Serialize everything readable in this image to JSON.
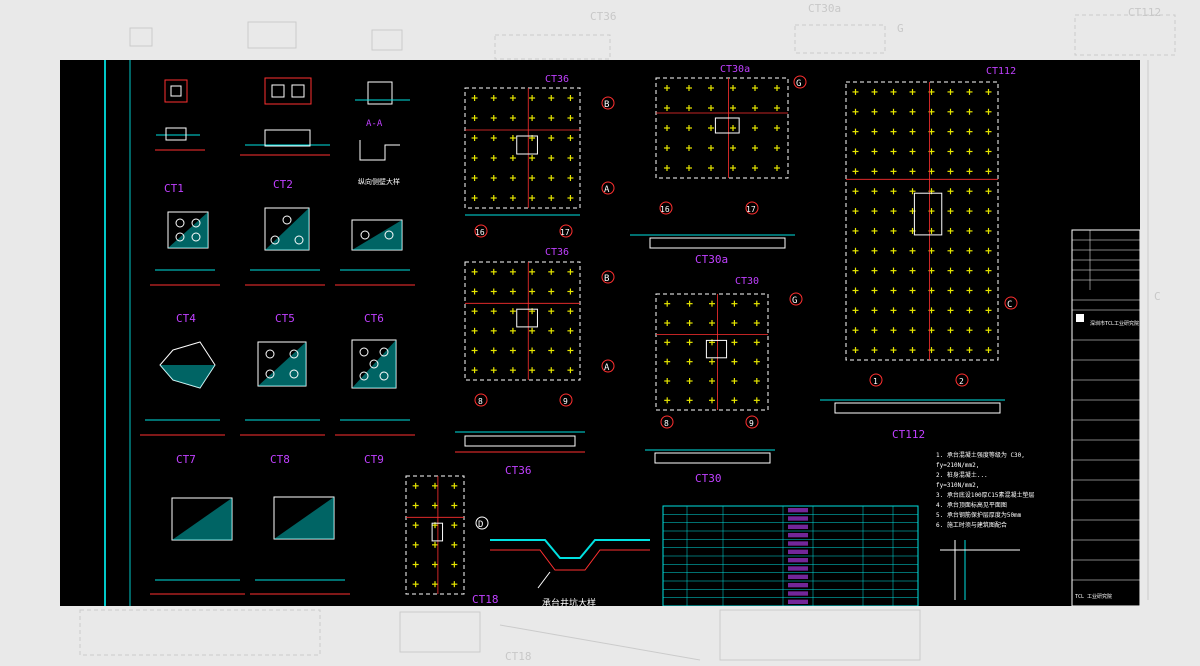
{
  "colors": {
    "page_bg": "#e9e9e9",
    "canvas_bg": "#000000",
    "label": "#c040ff",
    "pile": "#e6e600",
    "outline": "#ffffff",
    "dim": "#00e0e0",
    "rebar": "#ff3030",
    "hatch": "#00c8c8",
    "ghost": "#c8c8c8"
  },
  "ghost_labels": {
    "a": "CT36",
    "b": "CT30a",
    "c": "CT112",
    "d": "CT18"
  },
  "pile_caps": [
    {
      "label": "CT1"
    },
    {
      "label": "CT2"
    },
    {
      "label": "CT4"
    },
    {
      "label": "CT5"
    },
    {
      "label": "CT6"
    },
    {
      "label": "CT7"
    },
    {
      "label": "CT8"
    },
    {
      "label": "CT9"
    }
  ],
  "section_aa": {
    "title": "A-A",
    "caption": "纵向侧壁大样"
  },
  "plans": {
    "ct36a": {
      "label": "CT36",
      "axis_top": "B",
      "axis_bottom": "A",
      "axis_left": "16",
      "axis_right": "17"
    },
    "ct36b": {
      "label": "CT36",
      "axis_top": "B",
      "axis_bottom": "A",
      "axis_left": "8",
      "axis_right": "9"
    },
    "ct36_section": {
      "label": "CT36"
    },
    "ct30a": {
      "label": "CT30a",
      "axis_right": "G",
      "axis_left": "16",
      "axis_right2": "17",
      "section_label": "CT30a"
    },
    "ct30": {
      "label": "CT30",
      "axis_right": "G",
      "axis_left": "8",
      "axis_right2": "9",
      "section_label": "CT30"
    },
    "ct112": {
      "label": "CT112",
      "axis_right": "C",
      "axis_left": "1",
      "axis_right2": "2",
      "section_label": "CT112"
    },
    "ct18": {
      "label": "CT18",
      "axis": "D"
    },
    "detail": {
      "caption": "承台井坑大样"
    }
  },
  "title_block": {
    "company": "深圳市TCL工业研究院",
    "footer": "TCL 工业研究院"
  },
  "notes": {
    "n1": "1. 承台混凝土强度等级为 C30,",
    "n2": "   fy=210N/mm2,",
    "n3": "2. 桩身混凝土...",
    "n4": "   fy=310N/mm2,",
    "n5": "3. 承台底设100厚C15素混凝土垫层",
    "n6": "4. 承台顶面标高见平面图",
    "n7": "5. 承台钢筋保护层厚度为50mm",
    "n8": "6. 施工时须与建筑图配合"
  }
}
